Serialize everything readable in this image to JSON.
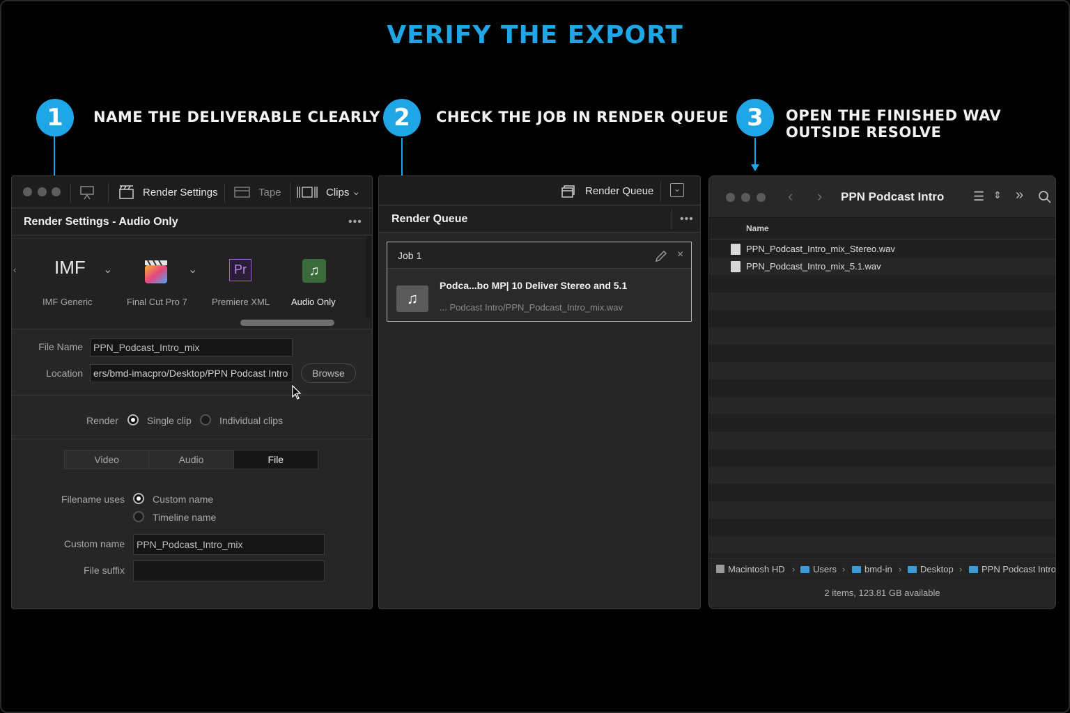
{
  "page_title": "VERIFY THE EXPORT",
  "steps": [
    {
      "number": "1",
      "text": "NAME THE DELIVERABLE CLEARLY"
    },
    {
      "number": "2",
      "text": "CHECK THE JOB IN RENDER QUEUE"
    },
    {
      "number": "3",
      "text_line1": "OPEN THE FINISHED WAV",
      "text_line2": "OUTSIDE RESOLVE"
    }
  ],
  "render_settings": {
    "toolbar": {
      "render_settings": "Render Settings",
      "tape": "Tape",
      "clips": "Clips"
    },
    "header": "Render Settings - Audio Only",
    "presets": [
      {
        "badge": "IMF",
        "label": "IMF Generic"
      },
      {
        "badge": "",
        "label": "Final Cut Pro 7"
      },
      {
        "badge": "Pr",
        "label": "Premiere XML"
      },
      {
        "badge": "♫",
        "label": "Audio Only"
      }
    ],
    "file_name_label": "File Name",
    "file_name_value": "PPN_Podcast_Intro_mix",
    "location_label": "Location",
    "location_value": "ers/bmd-imacpro/Desktop/PPN Podcast Intro",
    "browse": "Browse",
    "render_label": "Render",
    "single_clip": "Single clip",
    "individual_clips": "Individual clips",
    "tabs": [
      "Video",
      "Audio",
      "File"
    ],
    "filename_uses_label": "Filename uses",
    "custom_name_option": "Custom name",
    "timeline_name_option": "Timeline name",
    "custom_name_label": "Custom name",
    "custom_name_value": "PPN_Podcast_Intro_mix",
    "file_suffix_label": "File suffix",
    "file_suffix_value": ""
  },
  "render_queue": {
    "toolbar_label": "Render Queue",
    "header": "Render Queue",
    "job": {
      "name": "Job 1",
      "title": "Podca...bo MP| 10 Deliver Stereo and 5.1",
      "path": "... Podcast Intro/PPN_Podcast_Intro_mix.wav"
    }
  },
  "finder": {
    "title": "PPN Podcast Intro",
    "column_name": "Name",
    "files": [
      "PPN_Podcast_Intro_mix_Stereo.wav",
      "PPN_Podcast_Intro_mix_5.1.wav"
    ],
    "breadcrumb": [
      "Macintosh HD",
      "Users",
      "bmd-in",
      "Desktop",
      "PPN Podcast Intro"
    ],
    "status": "2 items, 123.81 GB available"
  },
  "colors": {
    "accent": "#1ea6e6",
    "background": "#000000",
    "panel": "#262626"
  }
}
